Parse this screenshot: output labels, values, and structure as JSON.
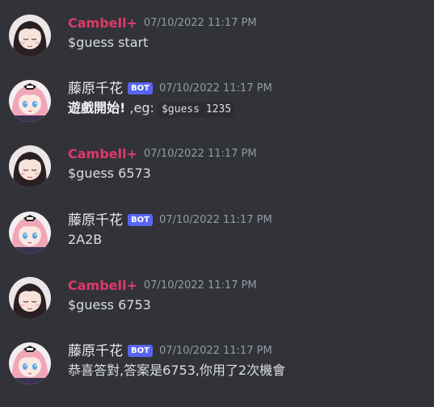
{
  "messages": [
    {
      "author": "Cambell+",
      "timestamp": "07/10/2022 11:17 PM",
      "text": "$guess start",
      "avatar": "anime-girl-dark-hair-avatar"
    },
    {
      "author": "藤原千花",
      "bot_tag": "BOT",
      "timestamp": "07/10/2022 11:17 PM",
      "text_bold": "遊戲開始!",
      "text_plain": " ,eg: ",
      "text_code": "$guess 1235",
      "avatar": "anime-girl-pink-hair-avatar"
    },
    {
      "author": "Cambell+",
      "timestamp": "07/10/2022 11:17 PM",
      "text": "$guess 6573",
      "avatar": "anime-girl-dark-hair-avatar"
    },
    {
      "author": "藤原千花",
      "bot_tag": "BOT",
      "timestamp": "07/10/2022 11:17 PM",
      "text": "2A2B",
      "avatar": "anime-girl-pink-hair-avatar"
    },
    {
      "author": "Cambell+",
      "timestamp": "07/10/2022 11:17 PM",
      "text": "$guess 6753",
      "avatar": "anime-girl-dark-hair-avatar"
    },
    {
      "author": "藤原千花",
      "bot_tag": "BOT",
      "timestamp": "07/10/2022 11:17 PM",
      "text": "恭喜答對,答案是6753,你用了2次機會",
      "avatar": "anime-girl-pink-hair-avatar"
    }
  ],
  "colors": {
    "background": "#313338",
    "user_name": "#e0396a",
    "bot_badge": "#5865f2",
    "timestamp": "#949ba4",
    "text": "#dbdee1"
  }
}
